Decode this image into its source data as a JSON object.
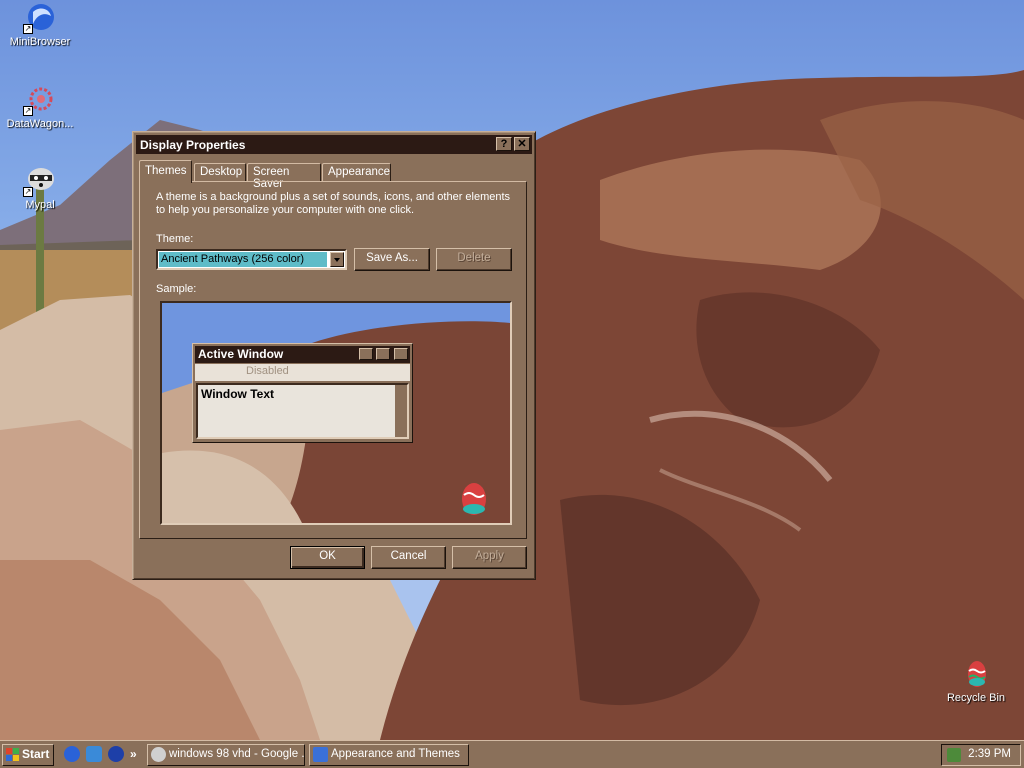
{
  "desktop": {
    "icons": [
      {
        "label": "MiniBrowser",
        "icon": "minibrowser-icon"
      },
      {
        "label": "DataWagon...",
        "icon": "datawagon-icon"
      },
      {
        "label": "Mypal",
        "icon": "mypal-raccoon-icon"
      },
      {
        "label": "Recycle Bin",
        "icon": "recycle-bin-icon"
      }
    ]
  },
  "dialog": {
    "title": "Display Properties",
    "help_button": "?",
    "close_button": "✕",
    "tabs": [
      "Themes",
      "Desktop",
      "Screen Saver",
      "Appearance"
    ],
    "active_tab": "Themes",
    "description_line1": "A theme is a background plus a set of sounds, icons, and other elements",
    "description_line2": "to help you personalize your computer with one click.",
    "theme_label": "Theme:",
    "theme_value": "Ancient Pathways (256 color)",
    "save_as_label": "Save As...",
    "delete_label": "Delete",
    "sample_label": "Sample:",
    "sample": {
      "window_title": "Active Window",
      "menu_text": "Disabled",
      "window_text": "Window Text"
    },
    "ok_label": "OK",
    "cancel_label": "Cancel",
    "apply_label": "Apply"
  },
  "taskbar": {
    "start_label": "Start",
    "quick_launch_chevron": "»",
    "tasks": [
      {
        "label": "windows 98 vhd - Google ...",
        "active": false
      },
      {
        "label": "Appearance and Themes",
        "active": false
      }
    ],
    "clock": "2:39 PM"
  },
  "colors": {
    "window_face": "#8a705a",
    "title_bar": "#2c1a14",
    "combo_highlight": "#5fbcc8"
  }
}
